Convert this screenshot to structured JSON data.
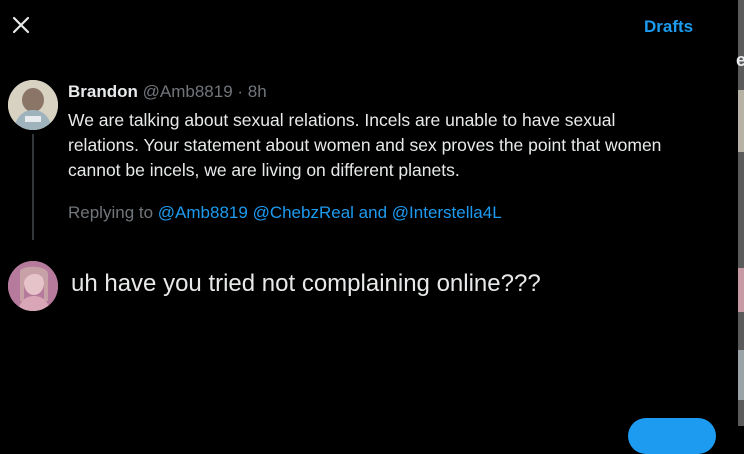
{
  "header": {
    "drafts_label": "Drafts"
  },
  "original_tweet": {
    "author_name": "Brandon",
    "author_handle": "@Amb8819",
    "separator": "·",
    "time": "8h",
    "text": "We are talking about sexual relations. Incels are unable to have sexual relations. Your statement about women and sex proves the point that women cannot be incels, we are living on different planets."
  },
  "replying_to": {
    "prefix": "Replying to",
    "mentions": [
      "@Amb8819",
      "@ChebzReal",
      "@Interstella4L"
    ],
    "and": "and"
  },
  "reply": {
    "text": "uh have you tried not complaining online???"
  },
  "edge_glyph": "e",
  "colors": {
    "accent": "#1d9bf0",
    "muted": "#71767b",
    "text": "#e7e9ea",
    "background": "#000000"
  }
}
